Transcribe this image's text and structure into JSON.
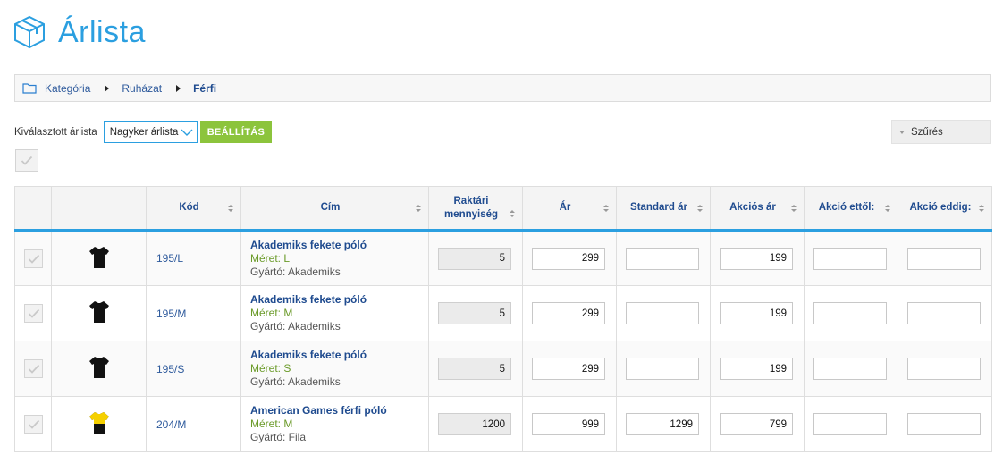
{
  "page": {
    "title": "Árlista"
  },
  "breadcrumb": {
    "items": [
      "Kategória",
      "Ruházat",
      "Férfi"
    ]
  },
  "toolbar": {
    "selected_label": "Kiválasztott árlista",
    "selected_value": "Nagyker árlista",
    "set_button": "BEÁLLÍTÁS",
    "filter_button": "Szűrés"
  },
  "table": {
    "headers": {
      "code": "Kód",
      "title": "Cím",
      "stock_line1": "Raktári",
      "stock_line2": "mennyiség",
      "price": "Ár",
      "standard_price": "Standard ár",
      "sale_price": "Akciós ár",
      "sale_from": "Akció ettől:",
      "sale_to": "Akció eddig:"
    },
    "rows": [
      {
        "code": "195/L",
        "name": "Akademiks fekete póló",
        "size_label": "Méret: L",
        "manufacturer_label": "Gyártó: Akademiks",
        "stock": "5",
        "price": "299",
        "standard_price": "",
        "sale_price": "199",
        "sale_from": "",
        "sale_to": "",
        "image_icon": "black-tshirt-icon"
      },
      {
        "code": "195/M",
        "name": "Akademiks fekete póló",
        "size_label": "Méret: M",
        "manufacturer_label": "Gyártó: Akademiks",
        "stock": "5",
        "price": "299",
        "standard_price": "",
        "sale_price": "199",
        "sale_from": "",
        "sale_to": "",
        "image_icon": "black-tshirt-icon"
      },
      {
        "code": "195/S",
        "name": "Akademiks fekete póló",
        "size_label": "Méret: S",
        "manufacturer_label": "Gyártó: Akademiks",
        "stock": "5",
        "price": "299",
        "standard_price": "",
        "sale_price": "199",
        "sale_from": "",
        "sale_to": "",
        "image_icon": "black-tshirt-icon"
      },
      {
        "code": "204/M",
        "name": "American Games férfi póló",
        "size_label": "Méret: M",
        "manufacturer_label": "Gyártó: Fila",
        "stock": "1200",
        "price": "999",
        "standard_price": "1299",
        "sale_price": "799",
        "sale_from": "",
        "sale_to": "",
        "image_icon": "yellow-black-tshirt-icon"
      }
    ]
  },
  "colors": {
    "accent": "#2b9fe0",
    "button_green": "#8cc43c",
    "link_blue": "#1f4b8f",
    "size_green": "#6a9a28"
  }
}
